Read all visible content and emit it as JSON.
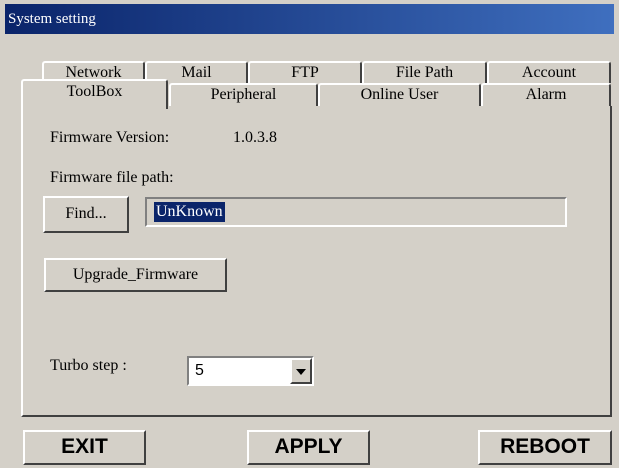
{
  "window": {
    "title": "System setting"
  },
  "tabs": {
    "row_back": [
      "Network",
      "Mail",
      "FTP",
      "File Path",
      "Account"
    ],
    "row_front": [
      "ToolBox",
      "Peripheral",
      "Online User",
      "Alarm"
    ],
    "active": "ToolBox"
  },
  "toolbox": {
    "firmware_version_label": "Firmware Version:",
    "firmware_version_value": "1.0.3.8",
    "firmware_path_label": "Firmware file path:",
    "find_button": "Find...",
    "path_value": "UnKnown",
    "upgrade_button": "Upgrade_Firmware",
    "turbo_label": "Turbo step :",
    "turbo_value": "5"
  },
  "footer": {
    "exit": "EXIT",
    "apply": "APPLY",
    "reboot": "REBOOT"
  },
  "colors": {
    "titlebar": "#0a246a",
    "face": "#d4d0c8",
    "selection": "#0a246a"
  }
}
